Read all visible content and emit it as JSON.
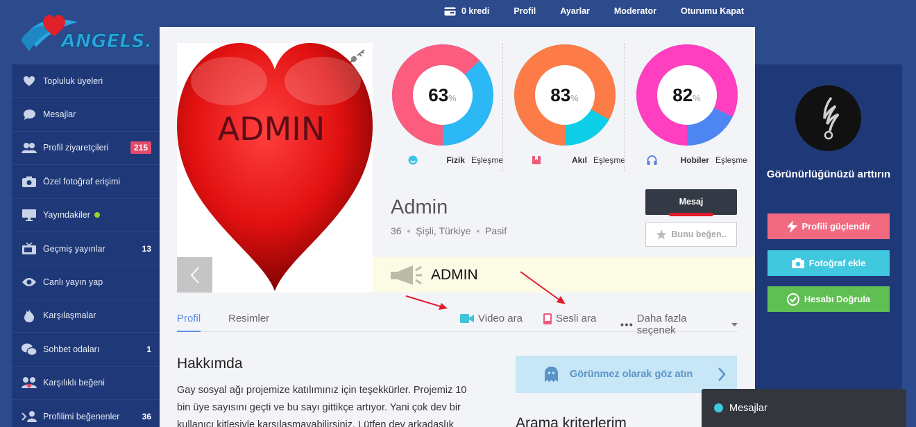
{
  "brand": {
    "logo_text": "ANGELS."
  },
  "topnav": {
    "credits": "0 kredi",
    "profile": "Profil",
    "settings": "Ayarlar",
    "moderator": "Moderator",
    "logout": "Oturumu Kapat"
  },
  "sidebar": {
    "items": [
      {
        "label": "Topluluk üyeleri",
        "icon": "heart-icon",
        "count": ""
      },
      {
        "label": "Mesajlar",
        "icon": "chat-bubble-icon",
        "count": ""
      },
      {
        "label": "Profil ziyaretçileri",
        "icon": "users-icon",
        "count": "215"
      },
      {
        "label": "Özel fotoğraf erişimi",
        "icon": "camera-icon",
        "count": ""
      },
      {
        "label": "Yayındakiler",
        "icon": "monitor-icon",
        "count": ""
      },
      {
        "label": "Geçmiş yayınlar",
        "icon": "tv-icon",
        "count": "13"
      },
      {
        "label": "Canlı yayın yap",
        "icon": "eye-icon",
        "count": ""
      },
      {
        "label": "Karşılaşmalar",
        "icon": "flame-icon",
        "count": ""
      },
      {
        "label": "Sohbet odaları",
        "icon": "chat-rooms-icon",
        "count": "1"
      },
      {
        "label": "Karşılıklı beğeni",
        "icon": "mutual-like-icon",
        "count": ""
      },
      {
        "label": "Profilimi beğenenler",
        "icon": "likers-icon",
        "count": "36"
      }
    ]
  },
  "profile": {
    "photo_text": "ADMIN",
    "name": "Admin",
    "age": "36",
    "location": "Şişli, Türkiye",
    "status": "Pasif",
    "message_button": "Mesaj",
    "like_button": "Bunu beğen..",
    "banner_text": "ADMIN"
  },
  "matches": [
    {
      "value": "63",
      "unit": "%",
      "name": "Fizik",
      "suffix": "Eşleşme",
      "fraction": 0.63,
      "color": "#fc5c7d",
      "rest_color": "#2cb8f5"
    },
    {
      "value": "83",
      "unit": "%",
      "name": "Akıl",
      "suffix": "Eşleşme",
      "fraction": 0.83,
      "color": "#fd7b46",
      "rest_color": "#0ecde6"
    },
    {
      "value": "82",
      "unit": "%",
      "name": "Hobiler",
      "suffix": "Eşleşme",
      "fraction": 0.82,
      "color": "#ff3fc0",
      "rest_color": "#4d86f2"
    }
  ],
  "tabs": {
    "profile": "Profil",
    "pictures": "Resimler",
    "video_call": "Video ara",
    "voice_call": "Sesli ara",
    "more": "Daha fazla seçenek"
  },
  "about": {
    "heading": "Hakkımda",
    "text": "Gay sosyal ağı projemize katılımınız için teşekkürler. Projemiz 10 bin üye sayısını geçti ve bu sayı gittikçe artıyor. Yani çok dev bir kullanıcı kitlesiyle karşılaşmayabilirsiniz. Lütfen dev arkadaşlık"
  },
  "invisible": {
    "label": "Görünmez olarak göz atın"
  },
  "search_criteria": {
    "heading": "Arama kriterlerim"
  },
  "right_panel": {
    "visibility": "Görünürlüğünüzü arttırın",
    "boost": "Profili güçlendir",
    "add_photo": "Fotoğraf ekle",
    "verify": "Hesabı Doğrula",
    "colors": {
      "boost": "#f26a80",
      "add_photo": "#3fc8de",
      "verify": "#5fbf52"
    }
  },
  "chat": {
    "label": "Mesajlar"
  }
}
